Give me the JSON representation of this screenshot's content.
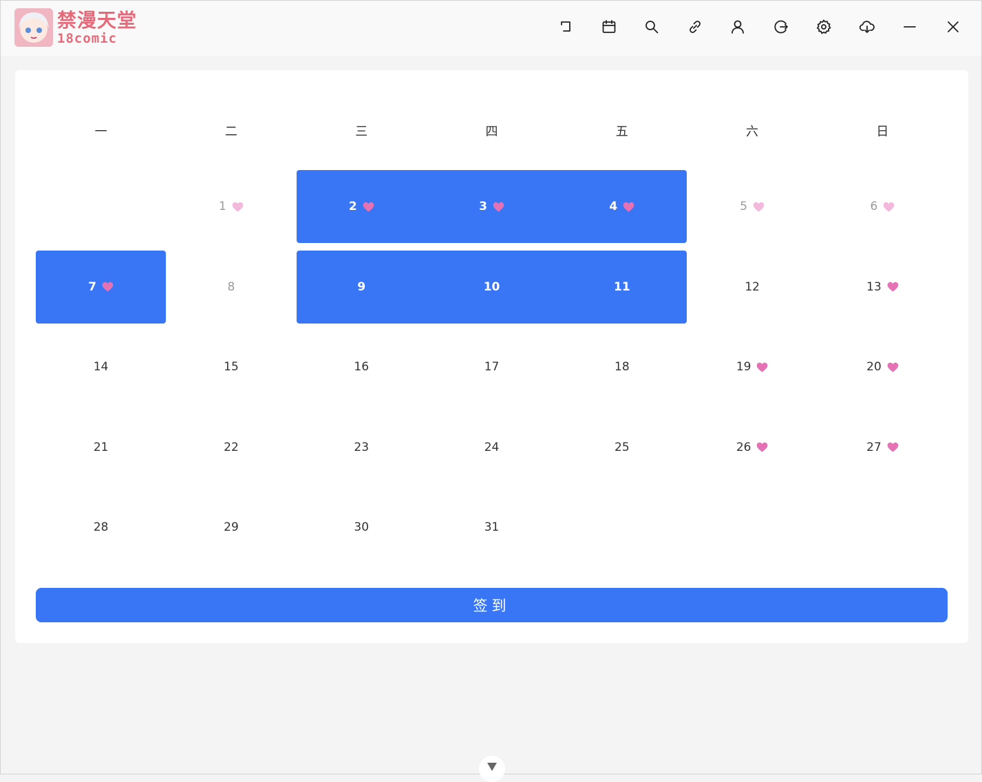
{
  "app": {
    "brand_title": "禁漫天堂",
    "brand_sub": "18comic"
  },
  "toolbar": {
    "buttons": [
      {
        "name": "back-button",
        "icon": "back-arrow-icon"
      },
      {
        "name": "calendar-button",
        "icon": "calendar-icon"
      },
      {
        "name": "search-button",
        "icon": "search-icon"
      },
      {
        "name": "link-button",
        "icon": "link-icon"
      },
      {
        "name": "user-button",
        "icon": "user-icon"
      },
      {
        "name": "logout-button",
        "icon": "logout-icon"
      },
      {
        "name": "settings-button",
        "icon": "gear-icon"
      },
      {
        "name": "download-button",
        "icon": "cloud-download-icon"
      },
      {
        "name": "minimize-button",
        "icon": "minimize-icon"
      },
      {
        "name": "close-button",
        "icon": "close-icon"
      }
    ]
  },
  "calendar": {
    "weekdays": [
      "一",
      "二",
      "三",
      "四",
      "五",
      "六",
      "日"
    ],
    "weeks": [
      [
        null,
        "1",
        "2",
        "3",
        "4",
        "5",
        "6"
      ],
      [
        "7",
        "8",
        "9",
        "10",
        "11",
        "12",
        "13"
      ],
      [
        "14",
        "15",
        "16",
        "17",
        "18",
        "19",
        "20"
      ],
      [
        "21",
        "22",
        "23",
        "24",
        "25",
        "26",
        "27"
      ],
      [
        "28",
        "29",
        "30",
        "31",
        null,
        null,
        null
      ]
    ],
    "signed_days": [
      1,
      2,
      3,
      4,
      5,
      6,
      7,
      13,
      19,
      20,
      26,
      27
    ],
    "muted_days": [
      1,
      5,
      6,
      8
    ],
    "selected_days": [
      2,
      3,
      4,
      7,
      9,
      10,
      11
    ],
    "heart_color_strong": "#e472b5",
    "heart_color_light": "#f2b9dd",
    "accent_color": "#3876f6"
  },
  "actions": {
    "sign_in_label": "签到"
  }
}
